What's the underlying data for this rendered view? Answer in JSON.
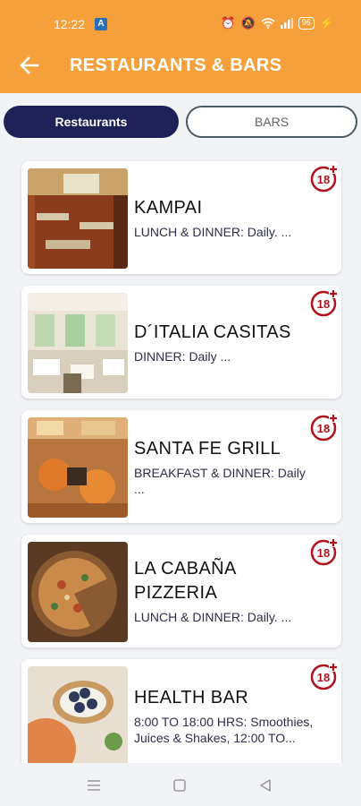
{
  "status": {
    "time": "12:22",
    "battery": "96"
  },
  "header": {
    "title": "RESTAURANTS & BARS"
  },
  "tabs": [
    {
      "label": "Restaurants",
      "active": true
    },
    {
      "label": "BARS",
      "active": false
    }
  ],
  "restaurants": [
    {
      "name": "KAMPAI",
      "description": "LUNCH & DINNER: Daily. ..."
    },
    {
      "name": "D´ITALIA CASITAS",
      "description": "DINNER: Daily ..."
    },
    {
      "name": "SANTA FE GRILL",
      "description": "BREAKFAST & DINNER: Daily ..."
    },
    {
      "name": "LA CABAÑA PIZZERIA",
      "description": "LUNCH & DINNER: Daily. ..."
    },
    {
      "name": "HEALTH BAR",
      "description": "8:00 TO 18:00 HRS: Smoothies, Juices & Shakes, 12:00 TO..."
    }
  ],
  "badge_label": "18+",
  "colors": {
    "header": "#f6a03c",
    "tab_active": "#1e2157",
    "badge": "#b3121b"
  },
  "icons": {
    "back": "arrow-left-icon",
    "badge": "age-18-plus-icon",
    "nav": [
      "menu-icon",
      "home-square-icon",
      "back-triangle-icon"
    ]
  }
}
